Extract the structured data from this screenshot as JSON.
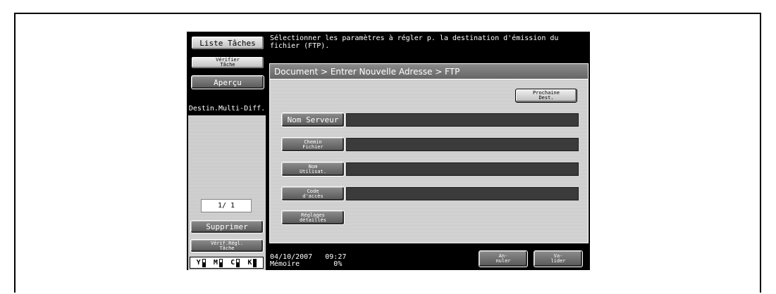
{
  "left_panel": {
    "job_list": "Liste Tâches",
    "check_job": "Vérifier\nTâche",
    "preview": "Aperçu",
    "multi_dest": "Destin.Multi-Diff.",
    "page_indicator": "1/ 1",
    "delete": "Supprimer",
    "check_settings": "Vérif.Régl.\nTâche"
  },
  "toner": [
    {
      "label": "Y",
      "level": 0.6
    },
    {
      "label": "M",
      "level": 0.6
    },
    {
      "label": "C",
      "level": 0.6
    },
    {
      "label": "K",
      "level": 1.0
    }
  ],
  "message": "Sélectionner les paramètres à régler p. la destination d'émission du fichier (FTP).",
  "breadcrumb": "Document > Entrer Nouvelle Adresse > FTP",
  "buttons": {
    "next_dest": "Prochaine\nDest.",
    "server_name": "Nom Serveur",
    "file_path": "Chemin\nFichier",
    "user_name": "Nom\nUtilisat.",
    "access_code": "Code\nd'accès",
    "detail_settings": "Réglages\ndétaillés",
    "cancel": "An-\nnuler",
    "ok": "Va-\nlider"
  },
  "status": {
    "date_time": "04/10/2007   09:27",
    "memory": "Mémoire        0%"
  }
}
